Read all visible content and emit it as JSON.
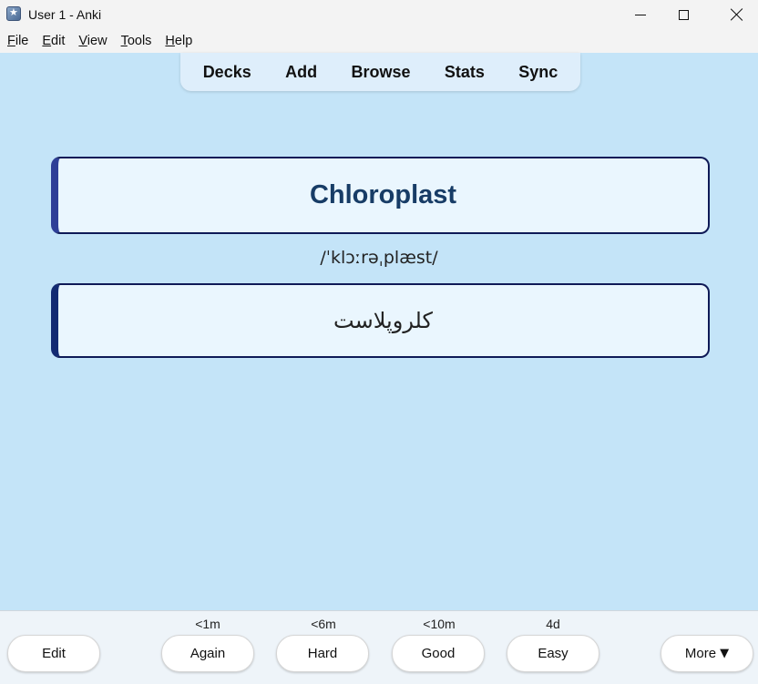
{
  "window": {
    "title": "User 1 - Anki"
  },
  "menu": {
    "items": [
      {
        "mnemonic": "F",
        "rest": "ile"
      },
      {
        "mnemonic": "E",
        "rest": "dit"
      },
      {
        "mnemonic": "V",
        "rest": "iew"
      },
      {
        "mnemonic": "T",
        "rest": "ools"
      },
      {
        "mnemonic": "H",
        "rest": "elp"
      }
    ]
  },
  "toolbar": {
    "decks": "Decks",
    "add": "Add",
    "browse": "Browse",
    "stats": "Stats",
    "sync": "Sync"
  },
  "card": {
    "front": "Chloroplast",
    "pronunciation": "/ˈklɔːrəˌplæst/",
    "back": "کلروپلاست"
  },
  "answer_bar": {
    "edit": "Edit",
    "again": {
      "label": "Again",
      "interval": "<1m"
    },
    "hard": {
      "label": "Hard",
      "interval": "<6m"
    },
    "good": {
      "label": "Good",
      "interval": "<10m"
    },
    "easy": {
      "label": "Easy",
      "interval": "4d"
    },
    "more": "More",
    "more_caret": "▼"
  },
  "colors": {
    "background": "#c4e4f8",
    "card_border": "#0f1a57",
    "front_text": "#173c66"
  }
}
